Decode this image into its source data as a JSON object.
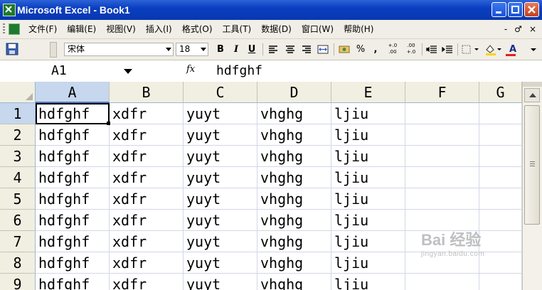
{
  "window": {
    "title": "Microsoft Excel - Book1"
  },
  "menu": {
    "items": [
      "文件(F)",
      "编辑(E)",
      "视图(V)",
      "插入(I)",
      "格式(O)",
      "工具(T)",
      "数据(D)",
      "窗口(W)",
      "帮助(H)"
    ],
    "doc_controls": [
      "-",
      "♂",
      "×"
    ]
  },
  "toolbar": {
    "font_name": "宋体",
    "font_size": "18",
    "bold_label": "B",
    "italic_label": "I",
    "underline_label": "U",
    "percent_label": "%",
    "comma_label": ",",
    "increase_decimal_label": "+.0 .00",
    "decrease_decimal_label": ".00 +.0",
    "font_color_label": "A",
    "accent_underline_color": "#e02020"
  },
  "formula_bar": {
    "name_box": "A1",
    "fx_label": "fx",
    "content": "hdfghf"
  },
  "sheet": {
    "columns": [
      "A",
      "B",
      "C",
      "D",
      "E",
      "F",
      "G"
    ],
    "active_column": "A",
    "active_cell": "A1",
    "rows": [
      {
        "num": "1",
        "cells": [
          "hdfghf",
          "xdfr",
          "yuyt",
          "vhghg",
          "ljiu",
          "",
          ""
        ]
      },
      {
        "num": "2",
        "cells": [
          "hdfghf",
          "xdfr",
          "yuyt",
          "vhghg",
          "ljiu",
          "",
          ""
        ]
      },
      {
        "num": "3",
        "cells": [
          "hdfghf",
          "xdfr",
          "yuyt",
          "vhghg",
          "ljiu",
          "",
          ""
        ]
      },
      {
        "num": "4",
        "cells": [
          "hdfghf",
          "xdfr",
          "yuyt",
          "vhghg",
          "ljiu",
          "",
          ""
        ]
      },
      {
        "num": "5",
        "cells": [
          "hdfghf",
          "xdfr",
          "yuyt",
          "vhghg",
          "ljiu",
          "",
          ""
        ]
      },
      {
        "num": "6",
        "cells": [
          "hdfghf",
          "xdfr",
          "yuyt",
          "vhghg",
          "ljiu",
          "",
          ""
        ]
      },
      {
        "num": "7",
        "cells": [
          "hdfghf",
          "xdfr",
          "yuyt",
          "vhghg",
          "ljiu",
          "",
          ""
        ]
      },
      {
        "num": "8",
        "cells": [
          "hdfghf",
          "xdfr",
          "yuyt",
          "vhghg",
          "ljiu",
          "",
          ""
        ]
      },
      {
        "num": "9",
        "cells": [
          "hdfghf",
          "xdfr",
          "yuyt",
          "vhghg",
          "ljiu",
          "",
          ""
        ]
      }
    ]
  },
  "watermark": {
    "brand": "Bai 经验",
    "url": "jingyan.baidu.com"
  }
}
